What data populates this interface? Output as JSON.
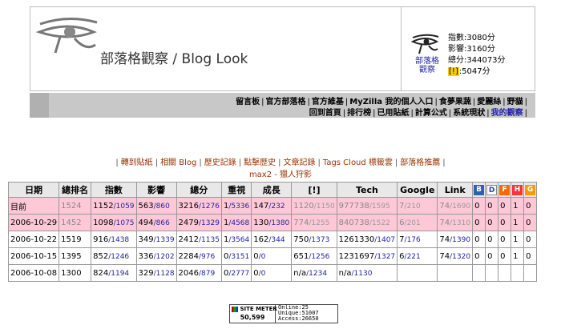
{
  "header": {
    "title": "部落格觀察 / Blog Look",
    "logo_icon": "eye-of-horus-icon",
    "stats": {
      "logo_label_line1": "部落格",
      "logo_label_line2": "觀察",
      "index": "指數:3080分",
      "influence": "影響:3160分",
      "total": "總分:344073分",
      "badge": "[!]",
      "badge_value": ":5047分"
    }
  },
  "menu": {
    "row1": [
      "留言板",
      "官方部落格",
      "官方維基",
      "MyZilla 我的個人入口",
      "食夢果蔬",
      "愛麗絲",
      "野貓"
    ],
    "row2": [
      "回到首頁",
      "排行榜",
      "已用貼紙",
      "計算公式",
      "系統現狀",
      "我的觀察"
    ],
    "active": "我的觀察"
  },
  "subnav": {
    "items": [
      "轉到貼紙",
      "相關 Blog",
      "歷史記錄",
      "點擊歷史",
      "文章記錄",
      "Tags Cloud 標籤雲",
      "部落格推薦"
    ],
    "note": "max2 - 獵人狩影"
  },
  "table": {
    "headers": [
      "日期",
      "總排名",
      "指數",
      "影響",
      "總分",
      "重視",
      "成長",
      "[!]",
      "Tech",
      "Google",
      "Link",
      "B",
      "D",
      "F",
      "H",
      "G"
    ],
    "rows": [
      {
        "pink": true,
        "date": "目前",
        "rank": "1524",
        "index": "1152",
        "index_sub": "/1059",
        "influence": "563",
        "influence_sub": "/860",
        "total": "3216",
        "total_sub": "/1276",
        "attention": "1",
        "attention_sub": "/5336",
        "growth": "147",
        "growth_sub": "/232",
        "bang": "1120",
        "bang_sub": "/1150",
        "tech": "977738",
        "tech_sub": "/1595",
        "google": "7",
        "google_sub": "/210",
        "link": "74",
        "link_sub": "/1690",
        "b": "0",
        "d": "0",
        "f": "0",
        "h": "1",
        "g": "0"
      },
      {
        "pink": true,
        "date": "2006-10-29",
        "rank": "1452",
        "index": "1098",
        "index_sub": "/1075",
        "influence": "494",
        "influence_sub": "/866",
        "total": "2479",
        "total_sub": "/1329",
        "attention": "1",
        "attention_sub": "/4568",
        "growth": "130",
        "growth_sub": "/1380",
        "bang": "774",
        "bang_sub": "/1255",
        "tech": "840738",
        "tech_sub": "/1522",
        "google": "6",
        "google_sub": "/201",
        "link": "74",
        "link_sub": "/1310",
        "b": "0",
        "d": "0",
        "f": "0",
        "h": "1",
        "g": "0"
      },
      {
        "pink": false,
        "date": "2006-10-22",
        "rank": "1519",
        "index": "916",
        "index_sub": "/1438",
        "influence": "349",
        "influence_sub": "/1339",
        "total": "2412",
        "total_sub": "/1135",
        "attention": "1",
        "attention_sub": "/3564",
        "growth": "162",
        "growth_sub": "/344",
        "bang": "750",
        "bang_sub": "/1373",
        "tech": "1261330",
        "tech_sub": "/1407",
        "google": "7",
        "google_sub": "/176",
        "link": "74",
        "link_sub": "/1390",
        "b": "0",
        "d": "0",
        "f": "0",
        "h": "1",
        "g": "0"
      },
      {
        "pink": false,
        "date": "2006-10-15",
        "rank": "1395",
        "index": "852",
        "index_sub": "/1246",
        "influence": "336",
        "influence_sub": "/1202",
        "total": "2284",
        "total_sub": "/976",
        "attention": "0",
        "attention_sub": "/3151",
        "growth": "0",
        "growth_sub": "/0",
        "bang": "651",
        "bang_sub": "/1256",
        "tech": "1231697",
        "tech_sub": "/1327",
        "google": "6",
        "google_sub": "/221",
        "link": "74",
        "link_sub": "/1320",
        "b": "0",
        "d": "0",
        "f": "0",
        "h": "1",
        "g": "0"
      },
      {
        "pink": false,
        "date": "2006-10-08",
        "rank": "1300",
        "index": "824",
        "index_sub": "/1194",
        "influence": "329",
        "influence_sub": "/1128",
        "total": "2046",
        "total_sub": "/879",
        "attention": "0",
        "attention_sub": "/2777",
        "growth": "0",
        "growth_sub": "/0",
        "bang": "n/a",
        "bang_sub": "/1234",
        "tech": "n/a",
        "tech_sub": "/1130",
        "google": "",
        "google_sub": "",
        "link": "",
        "link_sub": "",
        "b": "",
        "d": "",
        "f": "",
        "h": "",
        "g": ""
      }
    ]
  },
  "sitemeter": {
    "brand": "SITE METER",
    "count": "50,599",
    "online": "Online:25",
    "unique": "Unique:51007",
    "access": "Access:26650"
  }
}
